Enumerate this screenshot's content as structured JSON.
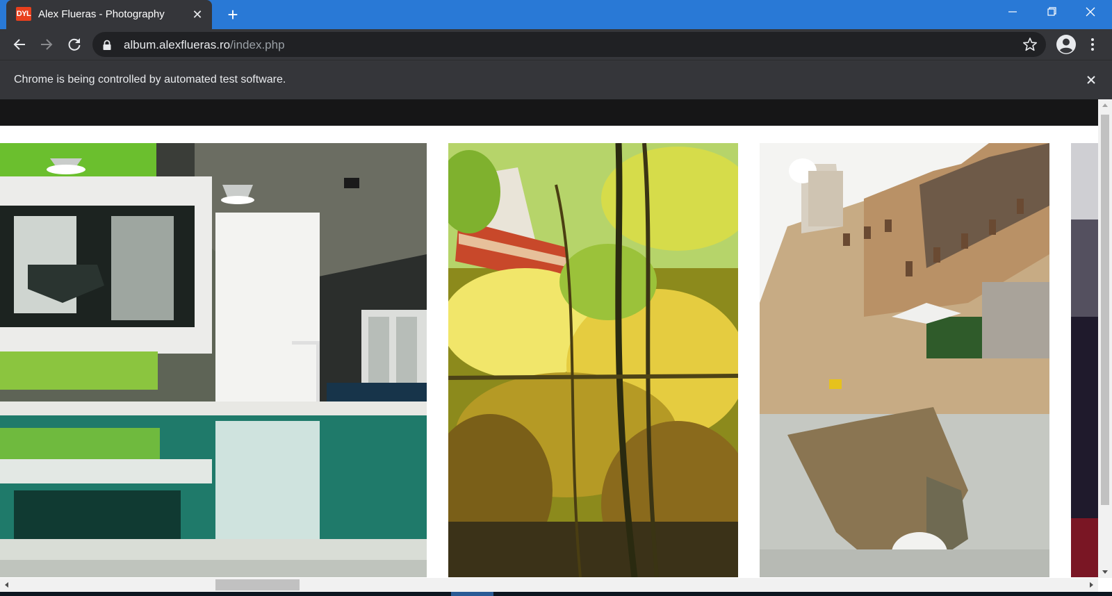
{
  "browser": {
    "tab": {
      "favicon_text": "DYL",
      "title": "Alex Flueras - Photography",
      "close_glyph": "✕"
    },
    "new_tab_glyph": "+",
    "window_controls": [
      "minimize-icon",
      "restore-icon",
      "close-icon"
    ],
    "address": {
      "host": "album.alexflueras.ro",
      "path": "/index.php"
    },
    "infobar": {
      "message": "Chrome is being controlled by automated test software."
    }
  },
  "colors": {
    "tab_strip": "#2979d6",
    "toolbar": "#35363a",
    "omnibox": "#202124",
    "site_header": "#161617"
  },
  "gallery": {
    "photos": [
      {
        "subject": "indoor-swimming-pool"
      },
      {
        "subject": "autumn-vine-leaves"
      },
      {
        "subject": "town-square-reflection"
      },
      {
        "subject": "partial-next-photo"
      }
    ]
  }
}
